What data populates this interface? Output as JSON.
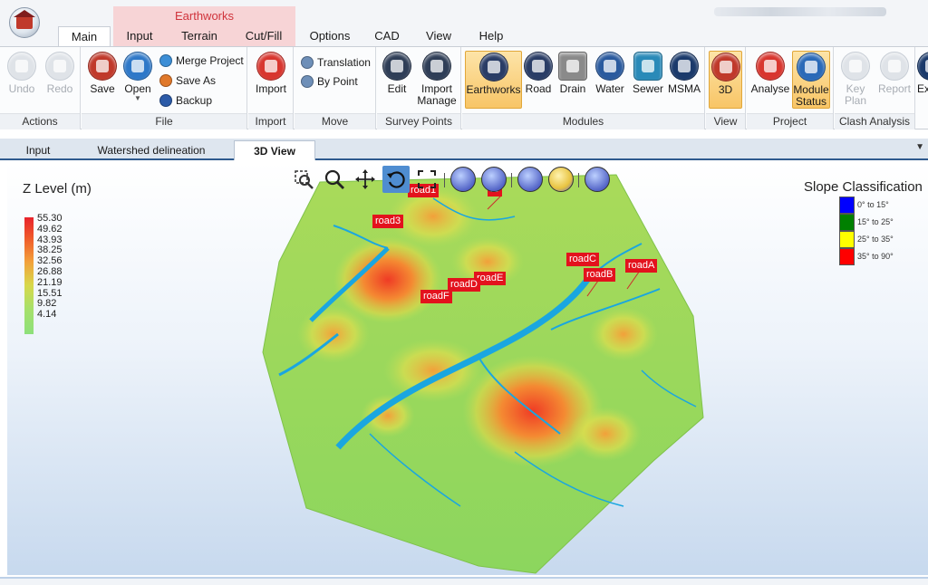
{
  "ribbon_tabs": {
    "context_group_label": "Earthworks",
    "tabs": [
      {
        "label": "Main",
        "active": true
      },
      {
        "label": "Input"
      },
      {
        "label": "Terrain"
      },
      {
        "label": "Cut/Fill"
      },
      {
        "label": "Options"
      },
      {
        "label": "CAD"
      },
      {
        "label": "View"
      },
      {
        "label": "Help"
      }
    ]
  },
  "ribbon": {
    "actions": {
      "label": "Actions",
      "undo": "Undo",
      "redo": "Redo"
    },
    "file": {
      "label": "File",
      "save": "Save",
      "open": "Open",
      "merge_project": "Merge Project",
      "save_as": "Save As",
      "backup": "Backup"
    },
    "import": {
      "label": "Import",
      "import": "Import"
    },
    "move": {
      "label": "Move",
      "translation": "Translation",
      "by_point": "By Point"
    },
    "survey_points": {
      "label": "Survey Points",
      "edit": "Edit",
      "import_manage": [
        "Import",
        "Manage"
      ]
    },
    "modules": {
      "label": "Modules",
      "earthworks": "Earthworks",
      "road": "Road",
      "drain": "Drain",
      "water": "Water",
      "sewer": "Sewer",
      "msma": "MSMA"
    },
    "view": {
      "label": "View",
      "three_d": "3D"
    },
    "project": {
      "label": "Project",
      "analyse": "Analyse",
      "module_status": [
        "Module",
        "Status"
      ]
    },
    "clash_analysis": {
      "label": "Clash Analysis",
      "key_plan": [
        "Key",
        "Plan"
      ],
      "report": "Report",
      "cut_off": "Ex"
    }
  },
  "doc_tabs": [
    {
      "label": "Input"
    },
    {
      "label": "Watershed delineation"
    },
    {
      "label": "3D View",
      "active": true
    }
  ],
  "viewport": {
    "z_level": {
      "title": "Z Level (m)",
      "values": [
        "55.30",
        "49.62",
        "43.93",
        "38.25",
        "32.56",
        "26.88",
        "21.19",
        "15.51",
        "9.82",
        "4.14"
      ]
    },
    "slope_classification": {
      "title": "Slope Classification",
      "classes": [
        {
          "label": "0° to 15°",
          "color": "#0000ff"
        },
        {
          "label": "15° to 25°",
          "color": "#008000"
        },
        {
          "label": "25° to 35°",
          "color": "#ffff00"
        },
        {
          "label": "35° to 90°",
          "color": "#ff0000"
        }
      ]
    },
    "road_labels": {
      "road1": "road1",
      "road_top": "ro",
      "road3": "road3",
      "roadC": "roadC",
      "roadA": "roadA",
      "roadB": "roadB",
      "roadE": "roadE",
      "roadD": "roadD",
      "roadF": "roadF"
    },
    "tool_icons": [
      "zoom-window-icon",
      "zoom-icon",
      "pan-icon",
      "rotate-icon",
      "zoom-extents-icon",
      "section-up-icon",
      "section-down-icon",
      "view-box-icon",
      "view-folder-icon",
      "view-cube-icon"
    ]
  },
  "colors": {
    "accent": "#2e5a8e",
    "highlight": "#f8c566",
    "road_label": "#e3121d",
    "context_tab": "#f7d4d6"
  }
}
